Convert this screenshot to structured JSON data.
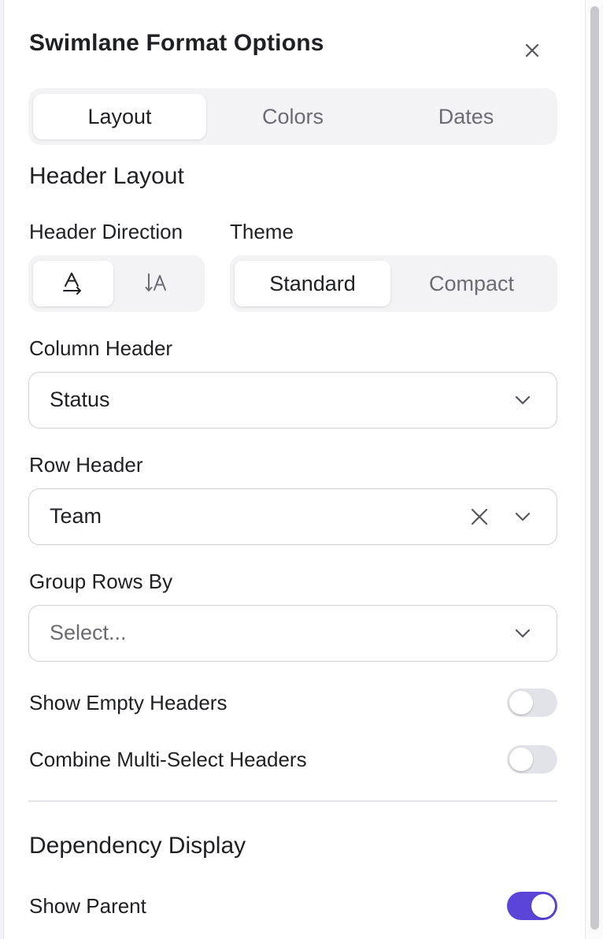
{
  "panel": {
    "title": "Swimlane Format Options",
    "close_icon": "close-icon"
  },
  "tabs": [
    {
      "label": "Layout",
      "active": true
    },
    {
      "label": "Colors",
      "active": false
    },
    {
      "label": "Dates",
      "active": false
    }
  ],
  "header_layout": {
    "heading": "Header Layout",
    "direction": {
      "label": "Header Direction",
      "options": [
        {
          "icon": "text-horizontal-icon",
          "active": true
        },
        {
          "icon": "text-vertical-icon",
          "active": false
        }
      ]
    },
    "theme": {
      "label": "Theme",
      "options": [
        {
          "label": "Standard",
          "active": true
        },
        {
          "label": "Compact",
          "active": false
        }
      ]
    }
  },
  "column_header": {
    "label": "Column Header",
    "value": "Status"
  },
  "row_header": {
    "label": "Row Header",
    "value": "Team"
  },
  "group_rows_by": {
    "label": "Group Rows By",
    "placeholder": "Select..."
  },
  "toggles": {
    "show_empty_headers": {
      "label": "Show Empty Headers",
      "on": false
    },
    "combine_multi_select": {
      "label": "Combine Multi-Select Headers",
      "on": false
    }
  },
  "dependency_display": {
    "heading": "Dependency Display",
    "show_parent": {
      "label": "Show Parent",
      "on": true
    }
  },
  "colors": {
    "accent": "#5b45d8",
    "toggle_off": "#e2e3e8",
    "text": "#1f2024",
    "muted": "#6b6c72"
  }
}
